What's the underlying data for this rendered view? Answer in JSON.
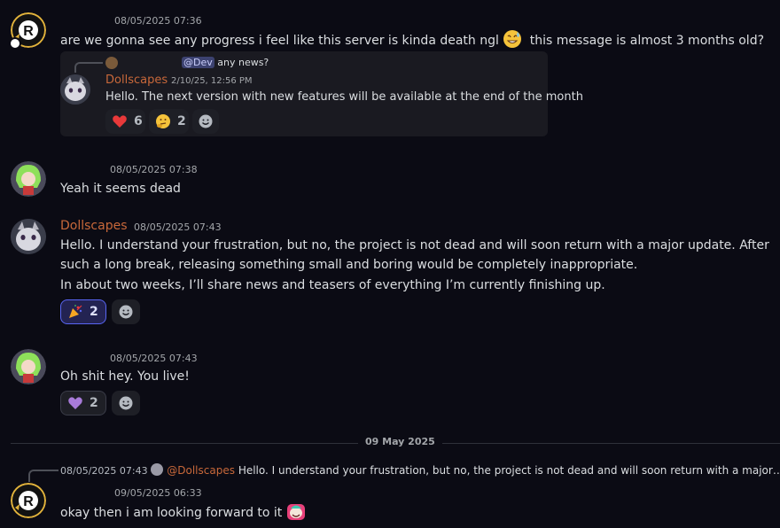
{
  "messages": {
    "m1": {
      "timestamp": "08/05/2025 07:36",
      "text_a": "are we gonna see any progress i feel like this server is kinda death ngl",
      "emoji": "sweat-smile",
      "text_b": "this message is almost 3 months old?"
    },
    "quote": {
      "reply_mention": "@Dev",
      "reply_text": "any news?",
      "author": "Dollscapes",
      "timestamp": "2/10/25, 12:56 PM",
      "text": "Hello. The next version with new features will be available at the end of the month",
      "reactions": [
        {
          "emoji": "heart-red-icon",
          "count": "6"
        },
        {
          "emoji": "thinking-face-icon",
          "count": "2"
        }
      ]
    },
    "m2": {
      "timestamp": "08/05/2025 07:38",
      "text": "Yeah it seems dead"
    },
    "m3": {
      "author": "Dollscapes",
      "timestamp": "08/05/2025 07:43",
      "line1": "Hello. I understand your frustration, but no, the project is not dead and will soon return with a major update. After",
      "line2": "such a long break, releasing something small and boring would be completely inappropriate.",
      "line3": "In about two weeks, I’ll share news and teasers of everything I’m currently finishing up.",
      "reactions": [
        {
          "emoji": "party-popper-icon",
          "count": "2"
        }
      ]
    },
    "m4": {
      "timestamp": "08/05/2025 07:43",
      "text": "Oh shit hey. You live!",
      "reactions": [
        {
          "emoji": "heart-purple-icon",
          "count": "2"
        }
      ]
    },
    "date_divider": "09 May 2025",
    "m5": {
      "reply_timestamp": "08/05/2025 07:43",
      "reply_mention": "@Dollscapes",
      "reply_text": "Hello. I understand your frustration, but no, the project is not dead and will soon return with a major…",
      "timestamp": "09/05/2025 06:33",
      "text": "okay then i am looking forward to it"
    }
  },
  "colors": {
    "background": "#0b0b14",
    "author_orange": "#c8683a",
    "mention_bg": "#3c4270",
    "active_reaction_border": "#5865f2"
  }
}
